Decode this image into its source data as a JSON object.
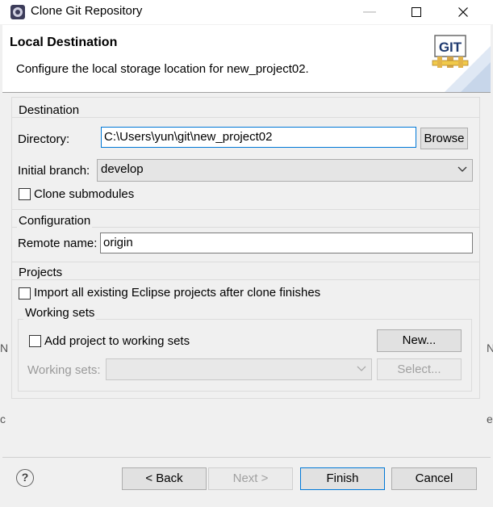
{
  "window": {
    "title": "Clone Git Repository",
    "minimize_glyph": "—",
    "maximize_glyph": "☐",
    "close_glyph": "✕"
  },
  "header": {
    "title": "Local Destination",
    "description": "Configure the local storage location for new_project02.",
    "logo_text": "GIT"
  },
  "destination": {
    "group_label": "Destination",
    "directory_label": "Directory:",
    "directory_value": "C:\\Users\\yun\\git\\new_project02",
    "browse_label": "Browse",
    "branch_label": "Initial branch:",
    "branch_value": "develop",
    "clone_submodules_label": "Clone submodules",
    "clone_submodules_checked": false
  },
  "configuration": {
    "group_label": "Configuration",
    "remote_label": "Remote name:",
    "remote_value": "origin"
  },
  "projects": {
    "group_label": "Projects",
    "import_label": "Import all existing Eclipse projects after clone finishes",
    "import_checked": false,
    "working_sets": {
      "group_label": "Working sets",
      "add_label": "Add project to working sets",
      "add_checked": false,
      "new_label": "New...",
      "sets_label": "Working sets:",
      "sets_value": "",
      "select_label": "Select..."
    }
  },
  "footer": {
    "help_glyph": "?",
    "back_label": "< Back",
    "next_label": "Next >",
    "finish_label": "Finish",
    "cancel_label": "Cancel"
  },
  "background_glyphs": {
    "left_top": "N",
    "left_bottom": "c",
    "right_top": "N",
    "right_bottom": "e"
  },
  "colors": {
    "accent": "#0078d7",
    "window_bg": "#f0f0f0",
    "header_bg": "#ffffff"
  }
}
